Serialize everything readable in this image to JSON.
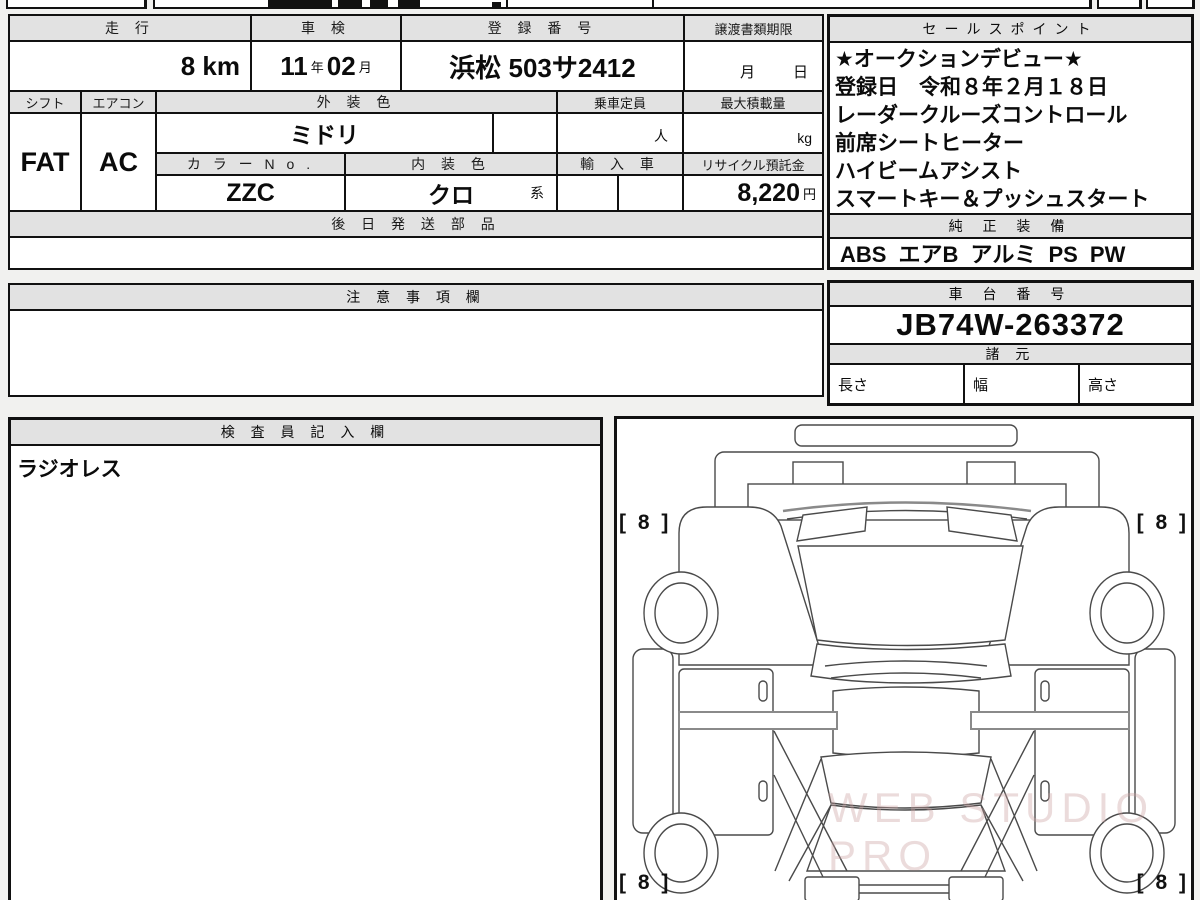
{
  "vehicle_table": {
    "mileage_header": "走 行",
    "mileage_value": "8 km",
    "inspection_header": "車 検",
    "inspection_year": "11",
    "inspection_year_unit": "年",
    "inspection_month": "02",
    "inspection_month_unit": "月",
    "registration_header": "登 録 番 号",
    "registration_value": "浜松 503サ2412",
    "transfer_header": "譲渡書類期限",
    "transfer_month_label": "月",
    "transfer_day_label": "日",
    "shift_header": "シフト",
    "shift_value": "FAT",
    "aircon_header": "エアコン",
    "aircon_value": "AC",
    "exterior_color_header": "外 装 色",
    "exterior_color_value": "ミドリ",
    "capacity_header": "乗車定員",
    "capacity_unit": "人",
    "max_load_header": "最大積載量",
    "max_load_unit": "kg",
    "color_no_header": "カ ラ ー N o .",
    "color_no_value": "ZZC",
    "interior_color_header": "内 装 色",
    "interior_color_value": "クロ",
    "interior_color_suffix": "系",
    "import_header": "輸 入 車",
    "recycle_header": "リサイクル預託金",
    "recycle_value": "8,220",
    "recycle_unit": "円",
    "later_parts_header": "後 日 発 送 部 品"
  },
  "sales_points": {
    "header": "セールスポイント",
    "lines": [
      "★オークションデビュー★",
      "登録日　令和８年２月１８日",
      "レーダークルーズコントロール",
      "前席シートヒーター",
      "ハイビームアシスト",
      "スマートキー＆プッシュスタート"
    ],
    "genuine_header": "純 正 装 備",
    "genuine_equipment": "ABS エアB アルミ PS PW"
  },
  "notes_section": {
    "header": "注 意 事 項 欄",
    "content": ""
  },
  "chassis_section": {
    "header": "車 台 番 号",
    "chassis_number": "JB74W-263372",
    "specs_header": "諸 元",
    "length_label": "長さ",
    "width_label": "幅",
    "height_label": "高さ",
    "length_value": "",
    "width_value": "",
    "height_value": ""
  },
  "inspector_section": {
    "header": "検 査 員 記 入 欄",
    "note": "ラジオレス"
  },
  "diagram_section": {
    "grade_front_left": "[ 8 ]",
    "grade_front_right": "[ 8 ]",
    "grade_rear_left": "[ 8 ]",
    "grade_rear_right": "[ 8 ]",
    "watermark": "WEB STUDIO PRO"
  }
}
